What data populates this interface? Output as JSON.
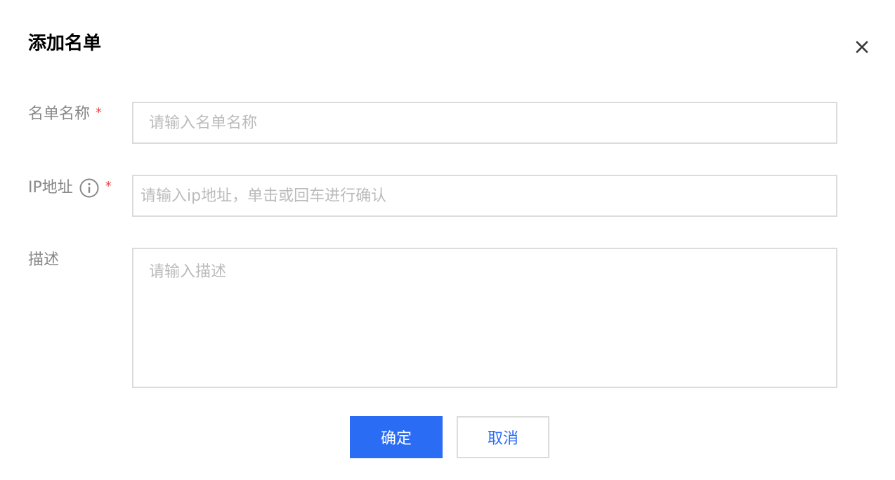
{
  "dialog": {
    "title": "添加名单",
    "close_icon": "close-icon"
  },
  "form": {
    "name": {
      "label": "名单名称",
      "required_mark": "*",
      "placeholder": "请输入名单名称",
      "value": ""
    },
    "ip": {
      "label": "IP地址",
      "required_mark": "*",
      "info_icon": "info-icon",
      "placeholder": "请输入ip地址，单击或回车进行确认",
      "value": ""
    },
    "description": {
      "label": "描述",
      "placeholder": "请输入描述",
      "value": ""
    }
  },
  "footer": {
    "ok_label": "确定",
    "cancel_label": "取消"
  },
  "colors": {
    "primary": "#2b6cf5",
    "required": "#e54545",
    "border": "#dcdcdc",
    "label": "#888888",
    "placeholder": "#bbbbbb"
  }
}
